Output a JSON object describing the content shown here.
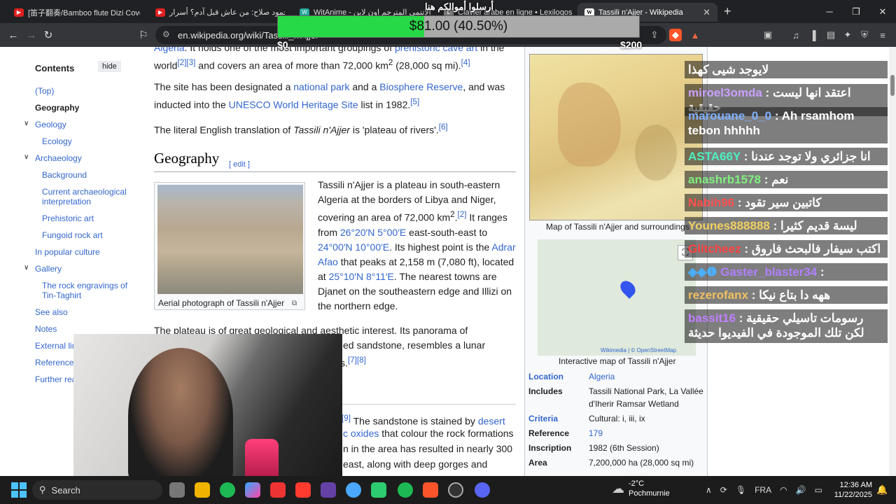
{
  "tabs": [
    {
      "label": "[笛子翻奏/Bamboo flute Dizi Cover][(",
      "icon": "youtube-icon"
    },
    {
      "label": "د. محمود صلاح: من عاش قبل آدم؟ أسرار",
      "icon": "youtube-icon"
    },
    {
      "label": "WitAnime - انمي الاتنمي المترجم اون لاين",
      "icon": "witanime-icon"
    },
    {
      "label": "Clavier arabe en ligne • Lexilogos",
      "icon": "lexilogos-icon"
    },
    {
      "label": "Tassili n'Ajjer - Wikipedia",
      "icon": "wikipedia-icon",
      "active": true
    }
  ],
  "address": {
    "url": "en.wikipedia.org/wiki/Tassili_n'Ajjer"
  },
  "donation": {
    "title": "أرسلوا أموالكم هنا",
    "amount": "$81.00 (40.50%)",
    "percent": 40.5,
    "min": "$0",
    "max": "$200"
  },
  "toc": {
    "title": "Contents",
    "hide": "hide",
    "items": [
      {
        "label": "(Top)"
      },
      {
        "label": "Geography",
        "current": true
      },
      {
        "label": "Geology",
        "chevron": true
      },
      {
        "label": "Ecology",
        "sub": true
      },
      {
        "label": "Archaeology",
        "chevron": true
      },
      {
        "label": "Background",
        "sub": true
      },
      {
        "label": "Current archaeological interpretation",
        "sub": true
      },
      {
        "label": "Prehistoric art",
        "sub": true
      },
      {
        "label": "Fungoid rock art",
        "sub": true
      },
      {
        "label": "In popular culture"
      },
      {
        "label": "Gallery",
        "chevron": true
      },
      {
        "label": "The rock engravings of Tin-Taghirt",
        "sub": true
      },
      {
        "label": "See also"
      },
      {
        "label": "Notes"
      },
      {
        "label": "External links"
      },
      {
        "label": "References"
      },
      {
        "label": "Further reading"
      }
    ]
  },
  "article": {
    "p1": {
      "a": "Algeria",
      "b": ". It holds one of the most important groupings of ",
      "c": "prehistoric cave art",
      "d": " in the world",
      "e": "[2][3]",
      "f": " and covers an area of more than 72,000 km",
      "g": "2",
      "h": " (28,000 sq mi).",
      "i": "[4]"
    },
    "p2": {
      "a": "The site has been designated a ",
      "b": "national park",
      "c": " and a ",
      "d": "Biosphere Reserve",
      "e": ", and was inducted into the ",
      "f": "UNESCO World Heritage Site",
      "g": " list in 1982.",
      "h": "[5]"
    },
    "p3": {
      "a": "The literal English translation of ",
      "b": "Tassili n'Ajjer",
      "c": " is 'plateau of rivers'.",
      "d": "[6]"
    },
    "geo_heading": "Geography",
    "geo_edit": "[ edit ]",
    "photo_caption": "Aerial photograph of Tassili n'Ajjer",
    "p4": {
      "a": "Tassili n'Ajjer is a plateau in south-eastern Algeria at the borders of Libya and Niger, covering an area of 72,000 km",
      "b": "2",
      "c": ".",
      "d": "[2]",
      "e": " It ranges from ",
      "f": "26°20′N 5°00′E",
      "g": " east-south-east to ",
      "h": "24°00′N 10°00′E",
      "i": ". Its highest point is the ",
      "j": "Adrar Afao",
      "k": " that peaks at 2,158 m (7,080 ft), located at ",
      "l": "25°10′N 8°11′E",
      "m": ". The nearest towns are Djanet on the southeastern edge and Illizi on the northern edge."
    },
    "p5": {
      "a": "The plateau is of great geological and aesthetic interest. Its panorama of geological",
      "b": "ed sandstone, resembles a lunar",
      "c": "s.",
      "d": "[7][8]"
    },
    "p6": {
      "a": "[9]",
      "b": " The sandstone is stained by ",
      "c": "desert",
      "d": "c oxides",
      "e": " that colour the rock formations",
      "f": "n in the area has resulted in nearly 300",
      "g": "east, along with deep gorges and"
    }
  },
  "infobox": {
    "map1_caption": "Map of Tassili n'Ajjer and surroundings",
    "map2_credit": "Wikimedia | © OpenStreetMap",
    "map2_caption": "Interactive map of Tassili n'Ajjer",
    "rows": [
      {
        "label": "Location",
        "value": "Algeria",
        "link": true
      },
      {
        "label": "Includes",
        "value": "Tassili National Park, La Vallée d'Iherir Ramsar Wetland"
      },
      {
        "label": "Criteria",
        "value": "Cultural: i, iii, ix",
        "label_link": true
      },
      {
        "label": "Reference",
        "value": "179"
      },
      {
        "label": "Inscription",
        "value": "1982 (6th Session)"
      },
      {
        "label": "Area",
        "value": "7,200,000 ha (28,000 sq mi)"
      }
    ]
  },
  "chat": [
    {
      "user": "",
      "msg": "لايوجد شيى كهذا"
    },
    {
      "user": "miroel3omda",
      "msg": ": اعتقد انها ليست حقيقية"
    },
    {
      "user": "marouane_0_0",
      "msg": ": Ah rsamhom tebon hhhhh"
    },
    {
      "user": "ASTA66Y",
      "msg": ": انا جزائري ولا توجد عندنا"
    },
    {
      "user": "anashrb1578",
      "msg": ": نعم"
    },
    {
      "user": "Nabih96",
      "msg": ": كاتبين سير تقود"
    },
    {
      "user": "Younes888888",
      "msg": ": ليسة قديم كثيرا"
    },
    {
      "user": "Glitcheez",
      "msg": ": اكتب سيفار فالبحث فاروق"
    },
    {
      "user": "Gaster_blaster34",
      "msg": ":"
    },
    {
      "user": "rezerofanx",
      "msg": ": ههه دا بتاع نيكا"
    },
    {
      "user": "bassit16",
      "msg": ": رسومات تاسيلي حقيقية لكن تلك الموجودة في الفيديوا حديثة"
    }
  ],
  "taskbar": {
    "search": "Search",
    "weather_temp": "-2°C",
    "weather_desc": "Pochmurnie",
    "lang": "FRA",
    "time": "12:36 AM",
    "date": "11/22/2025"
  }
}
